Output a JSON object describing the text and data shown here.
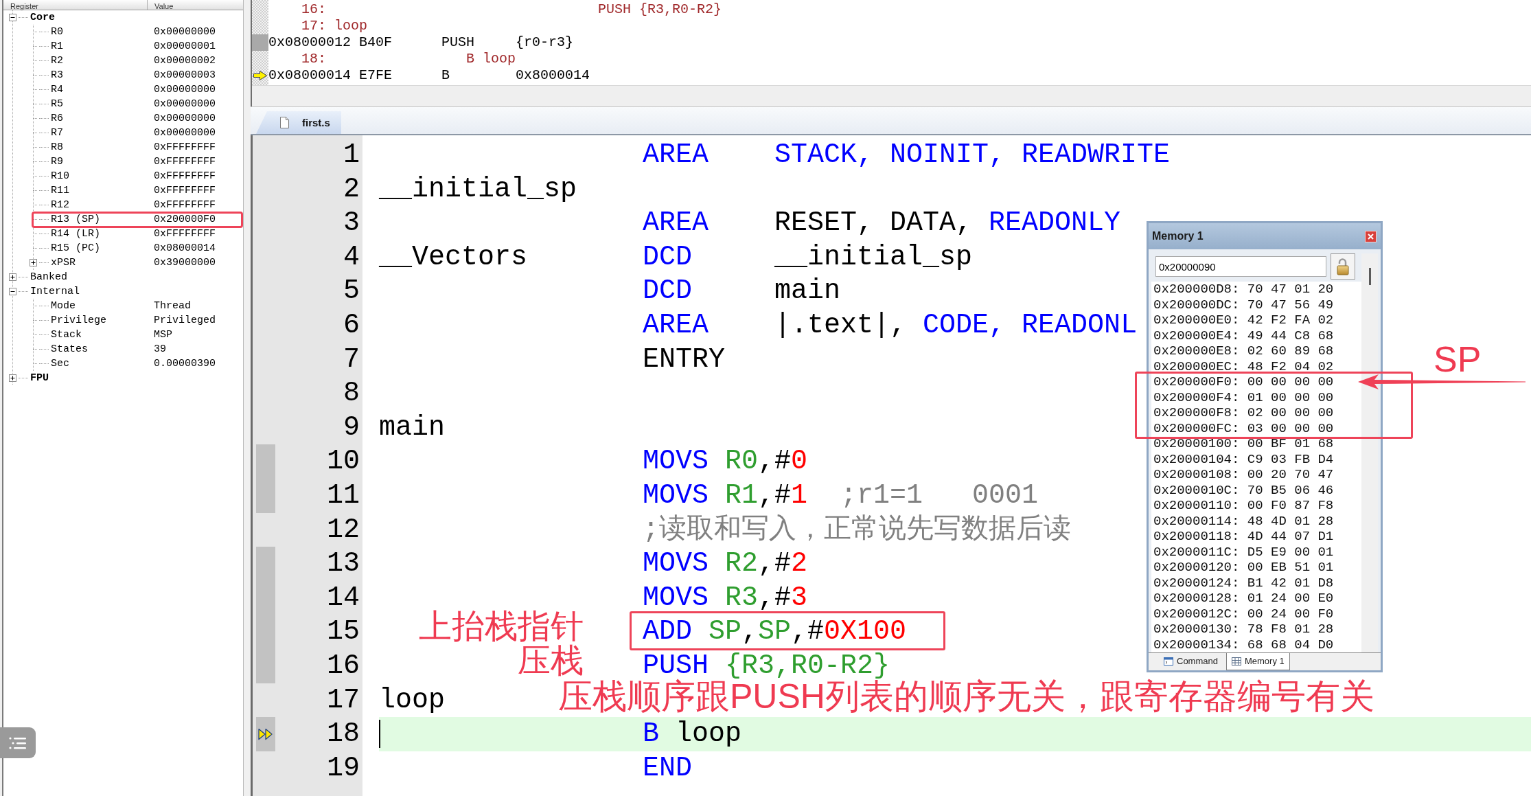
{
  "registers": {
    "columns": [
      "Register",
      "Value"
    ],
    "items": [
      {
        "name": "Core",
        "bold": true,
        "expanded": true,
        "children": [
          {
            "name": "R0",
            "value": "0x00000000",
            "highlighted": false
          },
          {
            "name": "R1",
            "value": "0x00000001",
            "highlighted": false
          },
          {
            "name": "R2",
            "value": "0x00000002",
            "highlighted": false
          },
          {
            "name": "R3",
            "value": "0x00000003",
            "highlighted": false
          },
          {
            "name": "R4",
            "value": "0x00000000",
            "highlighted": false
          },
          {
            "name": "R5",
            "value": "0x00000000",
            "highlighted": false
          },
          {
            "name": "R6",
            "value": "0x00000000",
            "highlighted": false
          },
          {
            "name": "R7",
            "value": "0x00000000",
            "highlighted": false
          },
          {
            "name": "R8",
            "value": "0xFFFFFFFF",
            "highlighted": false
          },
          {
            "name": "R9",
            "value": "0xFFFFFFFF",
            "highlighted": false
          },
          {
            "name": "R10",
            "value": "0xFFFFFFFF",
            "highlighted": false
          },
          {
            "name": "R11",
            "value": "0xFFFFFFFF",
            "highlighted": false
          },
          {
            "name": "R12",
            "value": "0xFFFFFFFF",
            "highlighted": false
          },
          {
            "name": "R13 (SP)",
            "value": "0x200000F0",
            "highlighted": true
          },
          {
            "name": "R14 (LR)",
            "value": "0xFFFFFFFF",
            "highlighted": false
          },
          {
            "name": "R15 (PC)",
            "value": "0x08000014",
            "highlighted": false
          },
          {
            "name": "xPSR",
            "value": "0x39000000",
            "highlighted": false,
            "expanded": false
          }
        ]
      },
      {
        "name": "Banked",
        "bold": false,
        "expanded": false
      },
      {
        "name": "Internal",
        "bold": false,
        "expanded": true,
        "children": [
          {
            "name": "Mode",
            "value": "Thread"
          },
          {
            "name": "Privilege",
            "value": "Privileged"
          },
          {
            "name": "Stack",
            "value": "MSP"
          },
          {
            "name": "States",
            "value": "39"
          },
          {
            "name": "Sec",
            "value": "0.00000390"
          }
        ]
      },
      {
        "name": "FPU",
        "bold": true,
        "expanded": false
      }
    ]
  },
  "disassembly": {
    "lines": [
      {
        "kind": "source",
        "text": "16:                                 PUSH {R3,R0-R2}",
        "current": false
      },
      {
        "kind": "source",
        "text": "17: loop",
        "current": false
      },
      {
        "kind": "instruction",
        "text": "0x08000012 B40F      PUSH     {r0-r3}",
        "current": false
      },
      {
        "kind": "source",
        "text": "18:                 B loop",
        "current": false
      },
      {
        "kind": "instruction",
        "text": "0x08000014 E7FE      B        0x8000014",
        "current": true
      }
    ]
  },
  "editor": {
    "tabs": [
      {
        "label": "first.s",
        "selected": true
      }
    ],
    "lines": [
      {
        "number": "1",
        "tokens": [
          {
            "kind": "keyword",
            "text": "AREA    STACK, NOINIT, READWRITE"
          }
        ],
        "executed": false,
        "current": false,
        "highlighted": false
      },
      {
        "number": "2",
        "label": "__initial_sp",
        "executed": false,
        "current": false,
        "highlighted": false
      },
      {
        "number": "3",
        "tokens": [
          {
            "kind": "keyword",
            "text": "AREA"
          },
          {
            "kind": "plain",
            "text": "    RESET, DATA, "
          },
          {
            "kind": "keyword",
            "text": "READONLY"
          }
        ],
        "executed": false,
        "current": false,
        "highlighted": false
      },
      {
        "number": "4",
        "label": "__Vectors",
        "tokens": [
          {
            "kind": "keyword",
            "text": "DCD"
          },
          {
            "kind": "plain",
            "text": "     __initial_sp"
          }
        ],
        "executed": false,
        "current": false,
        "highlighted": false
      },
      {
        "number": "5",
        "tokens": [
          {
            "kind": "keyword",
            "text": "DCD"
          },
          {
            "kind": "plain",
            "text": "     main"
          }
        ],
        "executed": false,
        "current": false,
        "highlighted": false
      },
      {
        "number": "6",
        "tokens": [
          {
            "kind": "keyword",
            "text": "AREA"
          },
          {
            "kind": "plain",
            "text": "    |.text|, "
          },
          {
            "kind": "keyword",
            "text": "CODE, READONL"
          }
        ],
        "executed": false,
        "current": false,
        "highlighted": false
      },
      {
        "number": "7",
        "tokens": [
          {
            "kind": "plain",
            "text": "ENTRY"
          }
        ],
        "executed": false,
        "current": false,
        "highlighted": false
      },
      {
        "number": "8",
        "executed": false,
        "current": false,
        "highlighted": false
      },
      {
        "number": "9",
        "label": "main",
        "executed": false,
        "current": false,
        "highlighted": false
      },
      {
        "number": "10",
        "tokens": [
          {
            "kind": "keyword",
            "text": "MOVS"
          },
          {
            "kind": "register",
            "text": " R0"
          },
          {
            "kind": "plain",
            "text": ",#"
          },
          {
            "kind": "number",
            "text": "0"
          }
        ],
        "executed": true,
        "current": false,
        "highlighted": false
      },
      {
        "number": "11",
        "tokens": [
          {
            "kind": "keyword",
            "text": "MOVS"
          },
          {
            "kind": "register",
            "text": " R1"
          },
          {
            "kind": "plain",
            "text": ",#"
          },
          {
            "kind": "number",
            "text": "1"
          },
          {
            "kind": "comment",
            "text": "  ;r1=1   0001"
          }
        ],
        "executed": true,
        "current": false,
        "highlighted": false
      },
      {
        "number": "12",
        "tokens": [
          {
            "kind": "comment",
            "text": ";读取和写入，正常说先写数据后读"
          }
        ],
        "executed": false,
        "current": false,
        "highlighted": false
      },
      {
        "number": "13",
        "tokens": [
          {
            "kind": "keyword",
            "text": "MOVS"
          },
          {
            "kind": "register",
            "text": " R2"
          },
          {
            "kind": "plain",
            "text": ",#"
          },
          {
            "kind": "number",
            "text": "2"
          }
        ],
        "executed": true,
        "current": false,
        "highlighted": false
      },
      {
        "number": "14",
        "tokens": [
          {
            "kind": "keyword",
            "text": "MOVS"
          },
          {
            "kind": "register",
            "text": " R3"
          },
          {
            "kind": "plain",
            "text": ",#"
          },
          {
            "kind": "number",
            "text": "3"
          }
        ],
        "executed": true,
        "current": false,
        "highlighted": false
      },
      {
        "number": "15",
        "tokens": [
          {
            "kind": "keyword",
            "text": "ADD"
          },
          {
            "kind": "register",
            "text": " SP"
          },
          {
            "kind": "plain",
            "text": ","
          },
          {
            "kind": "register",
            "text": "SP"
          },
          {
            "kind": "plain",
            "text": ",#"
          },
          {
            "kind": "number",
            "text": "0X100"
          }
        ],
        "executed": true,
        "current": false,
        "highlighted": true,
        "note": {
          "kind": "aside",
          "text": "上抬栈指针"
        }
      },
      {
        "number": "16",
        "tokens": [
          {
            "kind": "keyword",
            "text": "PUSH"
          },
          {
            "kind": "register",
            "text": " {R3,R0-R2}"
          }
        ],
        "executed": true,
        "current": false,
        "highlighted": false,
        "note": {
          "kind": "aside",
          "text": "压栈"
        }
      },
      {
        "number": "17",
        "label": "loop",
        "executed": false,
        "current": false,
        "highlighted": false,
        "note": {
          "kind": "banner",
          "text": "压栈顺序跟PUSH列表的顺序无关，跟寄存器编号有关"
        }
      },
      {
        "number": "18",
        "tokens": [
          {
            "kind": "keyword",
            "text": "B"
          },
          {
            "kind": "plain",
            "text": " loop"
          }
        ],
        "executed": true,
        "current": true,
        "highlighted": false
      },
      {
        "number": "19",
        "tokens": [
          {
            "kind": "keyword",
            "text": "END"
          }
        ],
        "executed": false,
        "current": false,
        "highlighted": false
      }
    ]
  },
  "memory": {
    "title": "Memory 1",
    "address": "0x20000090",
    "rows": [
      {
        "address": "0x200000D8:",
        "bytes": "70 47 01 20",
        "highlighted": false
      },
      {
        "address": "0x200000DC:",
        "bytes": "70 47 56 49",
        "highlighted": false
      },
      {
        "address": "0x200000E0:",
        "bytes": "42 F2 FA 02",
        "highlighted": false
      },
      {
        "address": "0x200000E4:",
        "bytes": "49 44 C8 68",
        "highlighted": false
      },
      {
        "address": "0x200000E8:",
        "bytes": "02 60 89 68",
        "highlighted": false
      },
      {
        "address": "0x200000EC:",
        "bytes": "48 F2 04 02",
        "highlighted": false
      },
      {
        "address": "0x200000F0:",
        "bytes": "00 00 00 00",
        "highlighted": true,
        "pointer": "SP"
      },
      {
        "address": "0x200000F4:",
        "bytes": "01 00 00 00",
        "highlighted": true
      },
      {
        "address": "0x200000F8:",
        "bytes": "02 00 00 00",
        "highlighted": true
      },
      {
        "address": "0x200000FC:",
        "bytes": "03 00 00 00",
        "highlighted": true
      },
      {
        "address": "0x20000100:",
        "bytes": "00 BF 01 68",
        "highlighted": false
      },
      {
        "address": "0x20000104:",
        "bytes": "C9 03 FB D4",
        "highlighted": false
      },
      {
        "address": "0x20000108:",
        "bytes": "00 20 70 47",
        "highlighted": false
      },
      {
        "address": "0x2000010C:",
        "bytes": "70 B5 06 46",
        "highlighted": false
      },
      {
        "address": "0x20000110:",
        "bytes": "00 F0 87 F8",
        "highlighted": false
      },
      {
        "address": "0x20000114:",
        "bytes": "48 4D 01 28",
        "highlighted": false
      },
      {
        "address": "0x20000118:",
        "bytes": "4D 44 07 D1",
        "highlighted": false
      },
      {
        "address": "0x2000011C:",
        "bytes": "D5 E9 00 01",
        "highlighted": false
      },
      {
        "address": "0x20000120:",
        "bytes": "00 EB 51 01",
        "highlighted": false
      },
      {
        "address": "0x20000124:",
        "bytes": "B1 42 01 D8",
        "highlighted": false
      },
      {
        "address": "0x20000128:",
        "bytes": "01 24 00 E0",
        "highlighted": false
      },
      {
        "address": "0x2000012C:",
        "bytes": "00 24 00 F0",
        "highlighted": false
      },
      {
        "address": "0x20000130:",
        "bytes": "78 F8 01 28",
        "highlighted": false
      },
      {
        "address": "0x20000134:",
        "bytes": "68 68 04 D0",
        "highlighted": false
      }
    ],
    "tabs": [
      {
        "kind": "command",
        "label": "Command",
        "selected": false
      },
      {
        "kind": "memory",
        "label": "Memory 1",
        "selected": true
      }
    ]
  }
}
